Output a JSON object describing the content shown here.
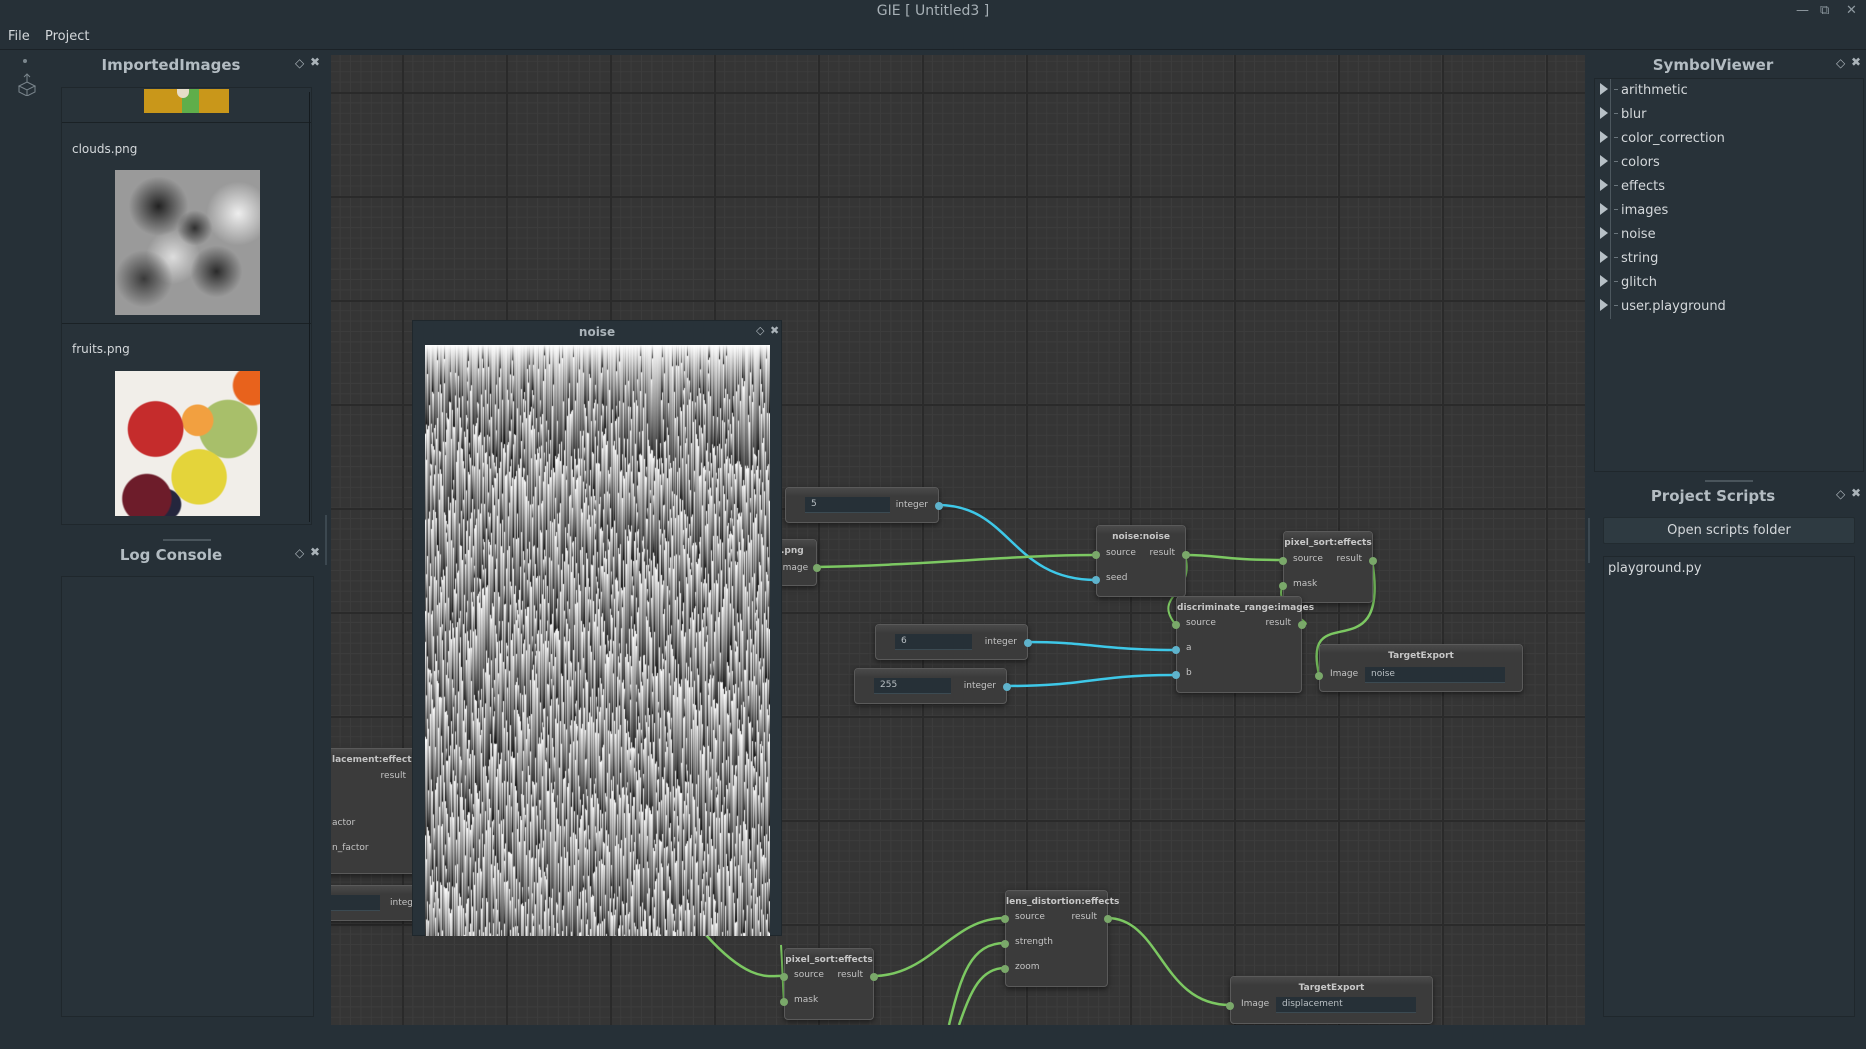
{
  "window": {
    "title": "GIE [ Untitled3 ]",
    "controls": [
      "minimize",
      "restore",
      "close"
    ]
  },
  "menu": [
    "File",
    "Project"
  ],
  "imported_images": {
    "title": "ImportedImages",
    "items": [
      {
        "name": "",
        "thumb": "partial-top-image"
      },
      {
        "name": "clouds.png",
        "thumb": "clouds"
      },
      {
        "name": "fruits.png",
        "thumb": "fruits"
      }
    ]
  },
  "log_console": {
    "title": "Log Console"
  },
  "symbol_viewer": {
    "title": "SymbolViewer",
    "items": [
      "arithmetic",
      "blur",
      "color_correction",
      "colors",
      "effects",
      "images",
      "noise",
      "string",
      "glitch",
      "user.playground"
    ]
  },
  "project_scripts": {
    "title": "Project Scripts",
    "open_button": "Open scripts folder",
    "files": [
      "playground.py"
    ]
  },
  "preview": {
    "title": "noise"
  },
  "nodes": {
    "int5": {
      "value": "5",
      "out": "integer"
    },
    "png": {
      "title": ".png",
      "out": "Image"
    },
    "noise": {
      "title": "noise:noise",
      "in": [
        "source",
        "seed"
      ],
      "out": "result"
    },
    "pixel_sort1": {
      "title": "pixel_sort:effects",
      "in": [
        "source",
        "mask"
      ],
      "out": "result"
    },
    "discriminate": {
      "title": "discriminate_range:images",
      "in": [
        "source",
        "a",
        "b"
      ],
      "out": "result"
    },
    "int6": {
      "value": "6",
      "out": "integer"
    },
    "int255": {
      "value": "255",
      "out": "integer"
    },
    "export1": {
      "title": "TargetExport",
      "in": "Image",
      "value": "noise"
    },
    "displacement": {
      "title": "lacement:effects",
      "out": "result",
      "in": [
        "actor",
        "n_factor"
      ]
    },
    "int_partial": {
      "out": "intege"
    },
    "pixel_sort2": {
      "title": "pixel_sort:effects",
      "in": [
        "source",
        "mask"
      ],
      "out": "result"
    },
    "lens": {
      "title": "lens_distortion:effects",
      "in": [
        "source",
        "strength",
        "zoom"
      ],
      "out": "result"
    },
    "export2": {
      "title": "TargetExport",
      "in": "Image",
      "value": "displacement"
    }
  },
  "colors": {
    "image_wire": "#7cc862",
    "int_wire": "#3ec8e8"
  }
}
